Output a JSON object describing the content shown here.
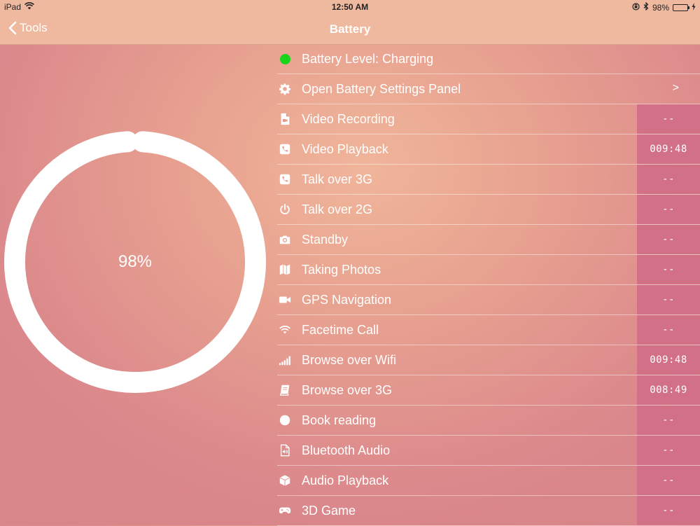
{
  "status_bar": {
    "device": "iPad",
    "time": "12:50 AM",
    "battery_percent_label": "98%",
    "battery_fill": 0.98
  },
  "nav": {
    "back_label": "Tools",
    "title": "Battery"
  },
  "gauge": {
    "label": "98%",
    "level": 0.98
  },
  "colors": {
    "charging_dot": "#19d41b",
    "value_column": "#d17087",
    "header": "#efb9a0"
  },
  "status_row": {
    "icon": "green-dot",
    "label": "Battery Level: Charging"
  },
  "settings_row": {
    "icon": "gear-icon",
    "label": "Open Battery Settings Panel",
    "chevron": ">"
  },
  "items": [
    {
      "icon": "video-file-icon",
      "label": "Video Recording",
      "value": "--"
    },
    {
      "icon": "phone-icon",
      "label": "Video Playback",
      "value": "009:48"
    },
    {
      "icon": "phone-icon",
      "label": "Talk over 3G",
      "value": "--"
    },
    {
      "icon": "power-icon",
      "label": "Talk over 2G",
      "value": "--"
    },
    {
      "icon": "camera-icon",
      "label": "Standby",
      "value": "--"
    },
    {
      "icon": "map-icon",
      "label": "Taking Photos",
      "value": "--"
    },
    {
      "icon": "video-camera-icon",
      "label": "GPS Navigation",
      "value": "--"
    },
    {
      "icon": "wifi-icon",
      "label": "Facetime Call",
      "value": "--"
    },
    {
      "icon": "signal-icon",
      "label": "Browse over Wifi",
      "value": "009:48"
    },
    {
      "icon": "book-icon",
      "label": "Browse over 3G",
      "value": "008:49"
    },
    {
      "icon": "circle-icon",
      "label": "Book reading",
      "value": "--"
    },
    {
      "icon": "audio-file-icon",
      "label": "Bluetooth Audio",
      "value": "--"
    },
    {
      "icon": "cube-icon",
      "label": "Audio Playback",
      "value": "--"
    },
    {
      "icon": "gamepad-icon",
      "label": "3D Game",
      "value": "--"
    }
  ]
}
